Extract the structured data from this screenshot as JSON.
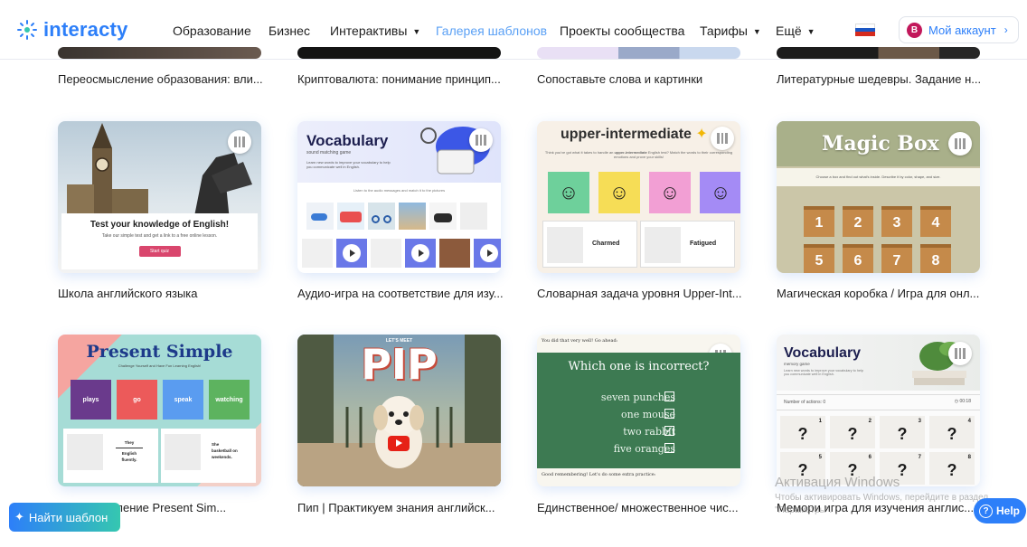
{
  "header": {
    "logo_text": "interacty",
    "nav": [
      {
        "label": "Образование",
        "caret": false,
        "active": false
      },
      {
        "label": "Бизнес",
        "caret": false,
        "active": false
      },
      {
        "label": "Интерактивы",
        "caret": true,
        "active": false
      },
      {
        "label": "Галерея шаблонов",
        "caret": false,
        "active": true
      },
      {
        "label": "Проекты сообщества",
        "caret": false,
        "active": false
      },
      {
        "label": "Тарифы",
        "caret": true,
        "active": false
      },
      {
        "label": "Ещё",
        "caret": true,
        "active": false
      }
    ],
    "avatar_letter": "B",
    "account_label": "Мой аккаунт",
    "account_chevron": "›"
  },
  "row0": {
    "captions": [
      "Переосмысление образования: вли...",
      "Криптовалюта: понимание принцип...",
      "Сопоставьте слова и картинки",
      "Литературные шедевры. Задание н..."
    ]
  },
  "row1": {
    "captions": [
      "Школа английского языка",
      "Аудио-игра на соответствие для изу...",
      "Словарная задача уровня Upper-Int...",
      "Магическая коробка / Игра для онл..."
    ],
    "card1": {
      "heading": "Test your knowledge of English!",
      "sub": "Take our simple test and get a link to a free online lesson.",
      "button": "Start quiz"
    },
    "card2": {
      "title": "Vocabulary",
      "subtitle": "sound matching game",
      "blurb": "Learn new words to improve your vocabulary to help you communicate well in English.",
      "instruction": "Listen to the audio messages and match it to the pictures"
    },
    "card3": {
      "title": "upper-intermediate",
      "blurb_pre": "Think you've got what it takes to handle an",
      "blurb_bold": "upper-intermediate",
      "blurb_post": "English test? Match the words to their corresponding emotions and prove your skills!",
      "word1": "Charmed",
      "word2": "Fatigued"
    },
    "card4": {
      "title": "Magic Box",
      "instruction": "Choose a box and find out what's inside. Describe it by color, shape, and size.",
      "numbers": [
        "1",
        "2",
        "3",
        "4",
        "5",
        "6",
        "7",
        "8"
      ]
    }
  },
  "row2": {
    "captions": [
      "оставление Present Sim...",
      "Пип | Практикуем знания английск...",
      "Единственное/ множественное чис...",
      "Мемори игра для изучения англис..."
    ],
    "card1": {
      "title_a": "Present",
      "title_b": "Simple",
      "subtitle": "Challenge Yourself and Have Fun Learning English!",
      "words": [
        "plays",
        "go",
        "speak",
        "watching"
      ],
      "sentence1": [
        "They",
        "English",
        "fluently."
      ],
      "sentence2": [
        "She",
        "basketball on",
        "weekends."
      ]
    },
    "card2": {
      "lets_meet": "LET'S MEET",
      "title": "PIP"
    },
    "card3": {
      "top_text": "You did that very well! Go ahead:",
      "question": "Which one is incorrect?",
      "options": [
        "seven punches",
        "one mouse",
        "two rabbit",
        "five oranges"
      ],
      "checked_index": 2,
      "bottom_text": "Good remembering! Let's do some extra practice:"
    },
    "card4": {
      "title": "Vocabulary",
      "subtitle": "memory game",
      "blurb": "Learn new words to improve your vocabulary to help you communicate well in English.",
      "actions_label": "Number of actions: 0",
      "timer": "00:18",
      "tiles": [
        "1",
        "2",
        "3",
        "4",
        "5",
        "6",
        "7",
        "8"
      ],
      "question_mark": "?"
    }
  },
  "watermark": {
    "line1": "Активация Windows",
    "line2": "Чтобы активировать Windows, перейдите в раздел",
    "line3": "\"Параметры\"."
  },
  "find_button": {
    "icon": "✦",
    "label": "Найти шаблон"
  },
  "help_button": {
    "icon": "?",
    "label": "Help"
  },
  "colors": {
    "accent": "#2d7ff9",
    "active_nav": "#5aa0f5",
    "avatar": "#c2185b"
  }
}
